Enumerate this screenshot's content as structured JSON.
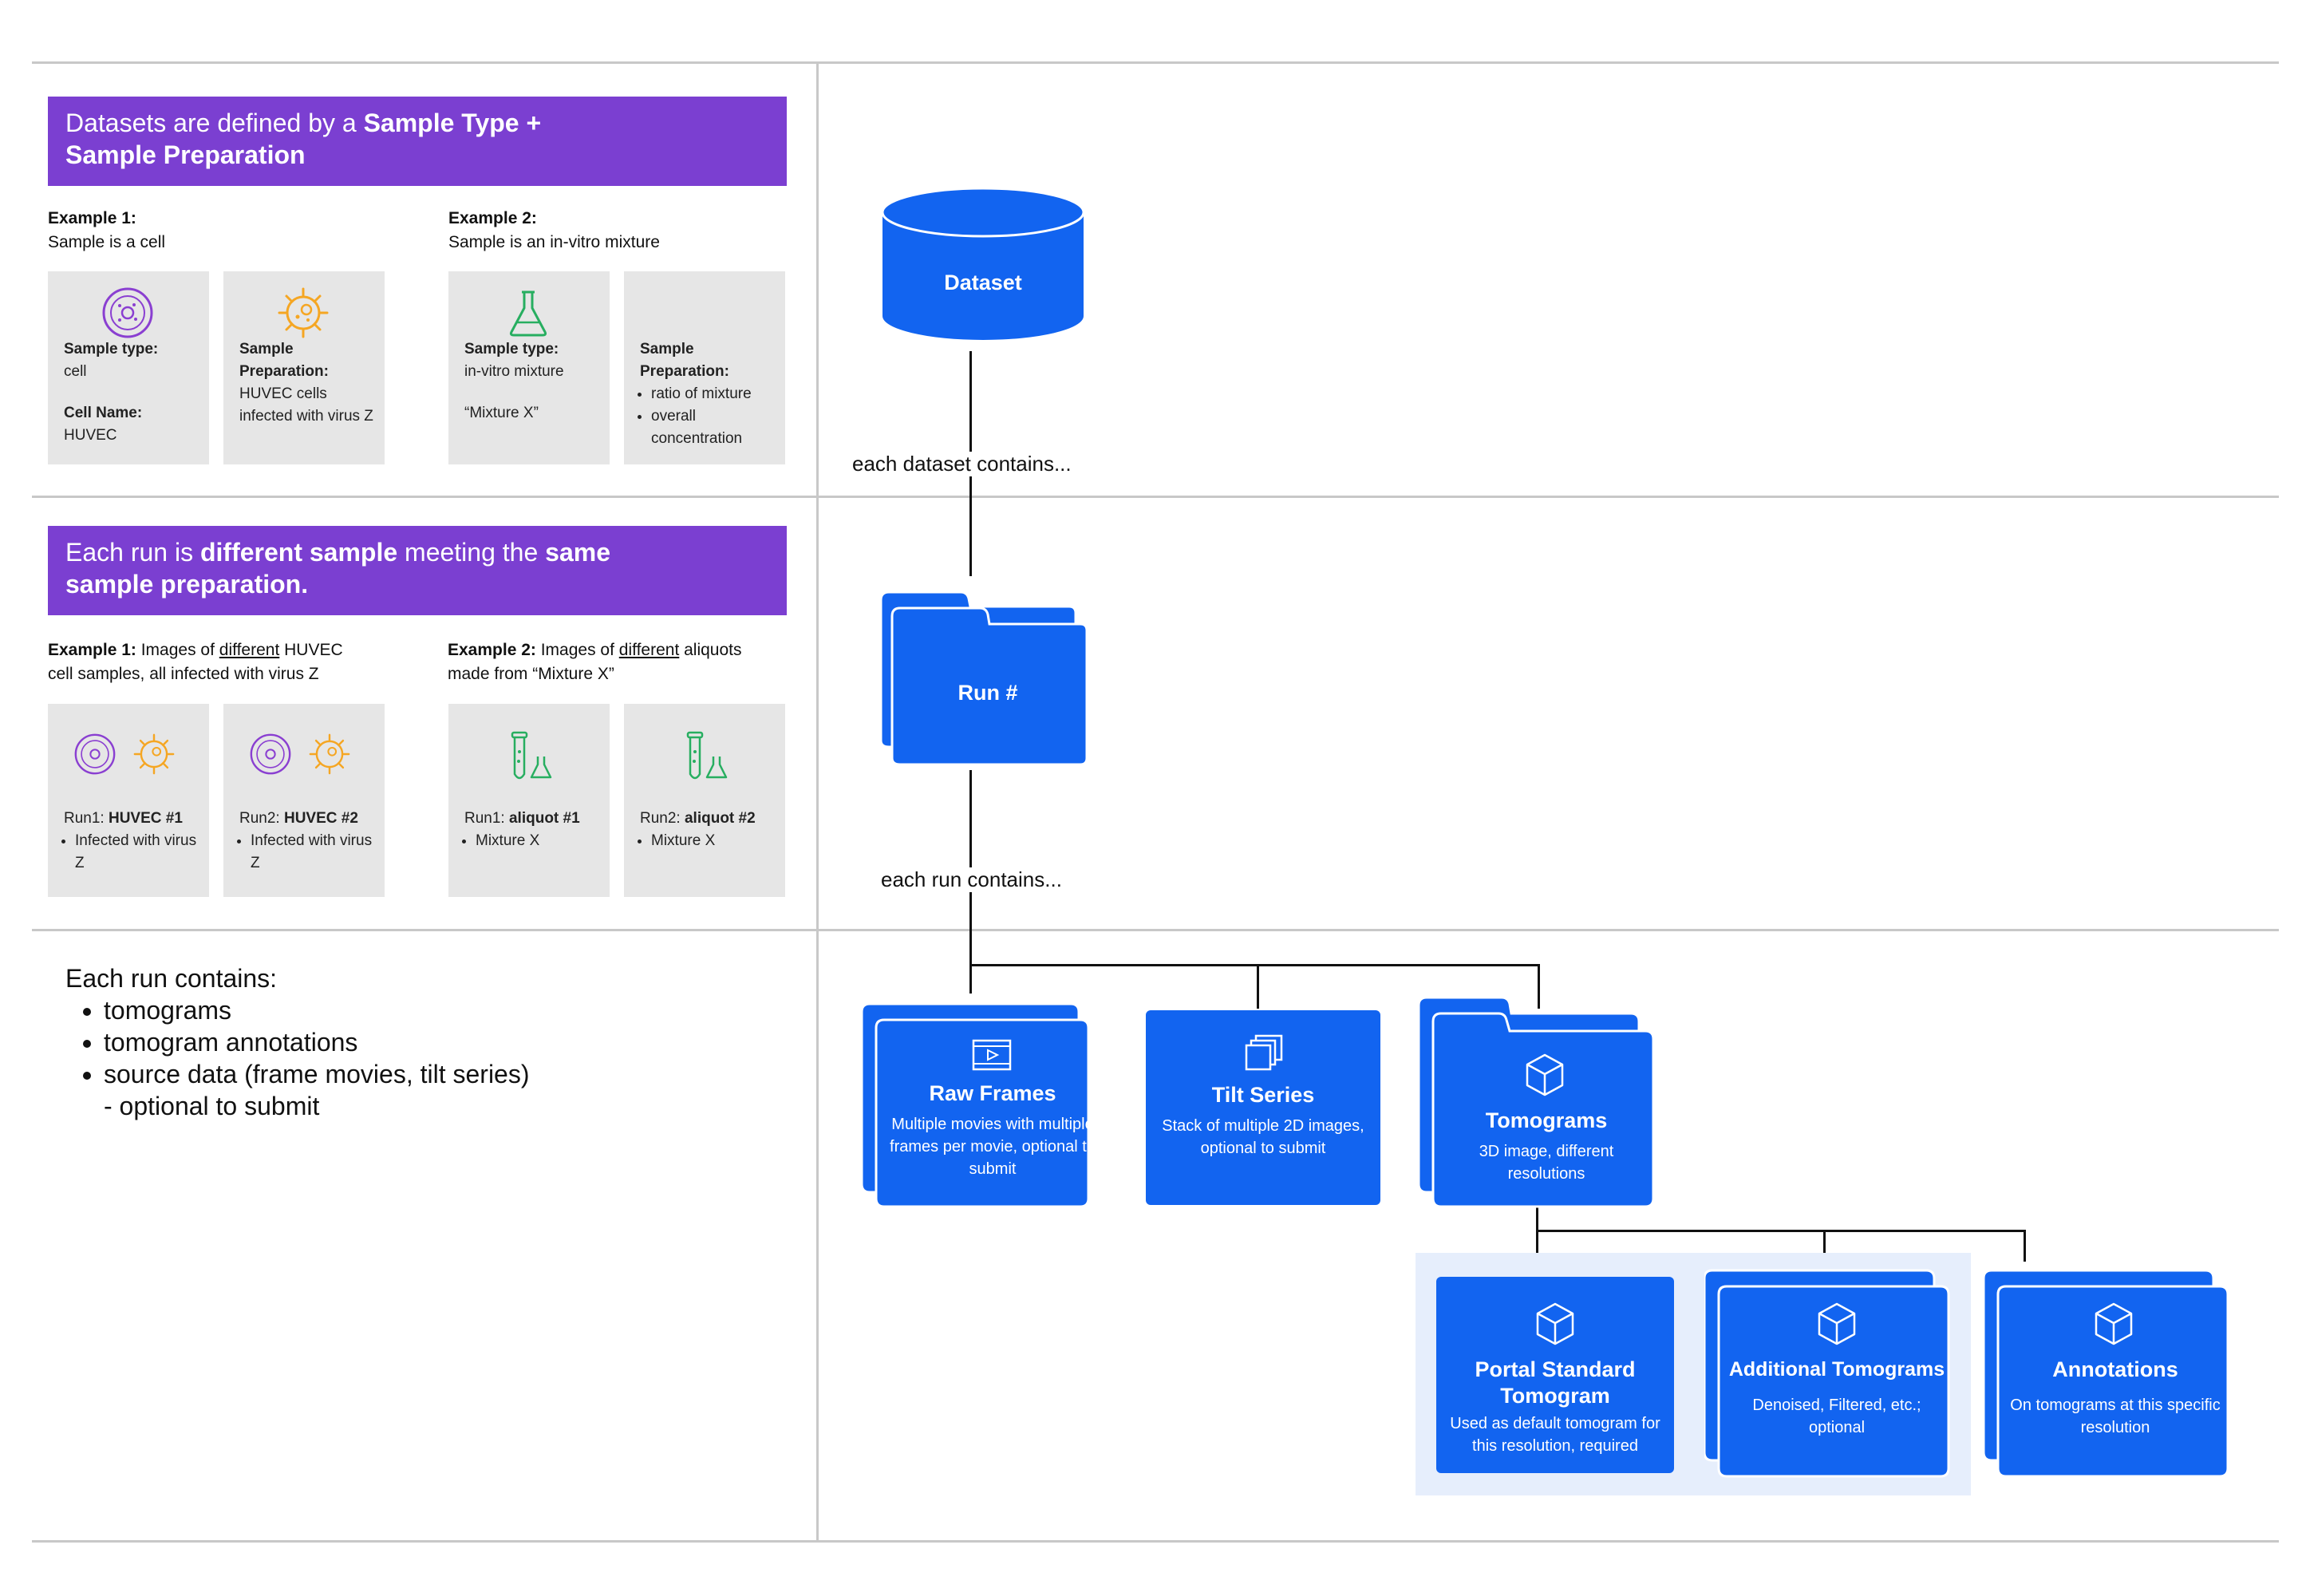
{
  "left": {
    "section1": {
      "banner": {
        "plain1": "Datasets are defined by a ",
        "bold1": "Sample Type +",
        "bold2": "Sample Preparation"
      },
      "example1": {
        "label": "Example 1:",
        "desc": "Sample is a cell"
      },
      "example2": {
        "label": "Example 2:",
        "desc": "Sample is an in-vitro mixture"
      },
      "cards": [
        {
          "label": "Sample type:",
          "value": "cell",
          "label2": "Cell Name:",
          "value2": "HUVEC",
          "icon": "cell-icon",
          "color": "#8a3fd1"
        },
        {
          "label": "Sample Preparation:",
          "value": "HUVEC cells infected with virus Z",
          "icon": "virus-icon",
          "color": "#f5a623"
        },
        {
          "label": "Sample type:",
          "value": "in-vitro mixture",
          "value2": "“Mixture X”",
          "icon": "flask-icon",
          "color": "#27ae60"
        },
        {
          "label": "Sample Preparation:",
          "bullets": [
            "ratio of mixture",
            "overall concentration"
          ]
        }
      ]
    },
    "section2": {
      "banner": {
        "plain1": "Each run is ",
        "bold1": "different sample",
        "plain2": " meeting the ",
        "bold2": "same",
        "bold3": "sample preparation."
      },
      "example1": {
        "label": "Example 1:",
        "pre": " Images of ",
        "underlined": "different",
        "post": " HUVEC",
        "line2": "cell samples, all infected with virus Z"
      },
      "example2": {
        "label": "Example 2:",
        "pre": " Images of ",
        "underlined": "different",
        "post": " aliquots",
        "line2": "made from “Mixture X”"
      },
      "cards": [
        {
          "prefix": "Run1: ",
          "bold": "HUVEC #1",
          "bullet": "Infected with virus Z"
        },
        {
          "prefix": "Run2: ",
          "bold": "HUVEC #2",
          "bullet": "Infected with virus Z"
        },
        {
          "prefix": "Run1: ",
          "bold": "aliquot #1",
          "bullet": "Mixture X"
        },
        {
          "prefix": "Run2: ",
          "bold": "aliquot #2",
          "bullet": "Mixture X"
        }
      ]
    },
    "section3": {
      "heading": "Each run contains:",
      "items": [
        "tomograms",
        "tomogram annotations",
        "source data (frame movies, tilt series)"
      ],
      "note": "- optional to submit"
    }
  },
  "diagram": {
    "dataset": "Dataset",
    "each_dataset": "each dataset contains...",
    "run": "Run #",
    "each_run": "each run contains...",
    "raw_frames": {
      "title": "Raw Frames",
      "sub": "Multiple movies with multiple frames per movie, optional to submit"
    },
    "tilt_series": {
      "title": "Tilt Series",
      "sub": "Stack of multiple 2D images, optional to submit"
    },
    "tomograms": {
      "title": "Tomograms",
      "sub": "3D image, different resolutions"
    },
    "portal_standard": {
      "title": "Portal Standard Tomogram",
      "sub": "Used as default tomogram for this resolution, required"
    },
    "additional": {
      "title": "Additional Tomograms",
      "sub": "Denoised, Filtered, etc.; optional"
    },
    "annotations": {
      "title": "Annotations",
      "sub": "On tomograms at this specific resolution"
    },
    "colors": {
      "blue": "#1264f0",
      "purple": "#7b3fd1",
      "panel": "#e6eefc"
    }
  }
}
